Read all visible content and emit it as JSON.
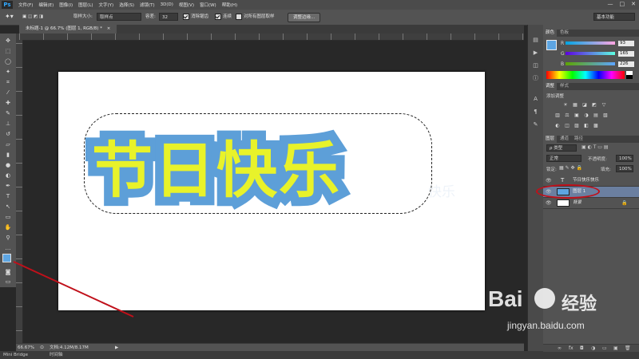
{
  "app": {
    "logo": "Ps"
  },
  "menu": [
    "文件(F)",
    "编辑(E)",
    "图像(I)",
    "图层(L)",
    "文字(Y)",
    "选择(S)",
    "滤镜(T)",
    "3D(D)",
    "视图(V)",
    "窗口(W)",
    "帮助(H)"
  ],
  "window_controls": [
    "—",
    "□",
    "✕"
  ],
  "options": {
    "sample_size_label": "取样大小:",
    "sample_size_value": "取样点",
    "tolerance_label": "容差:",
    "tolerance_value": "32",
    "antialias_label": "消除锯齿",
    "contiguous_label": "连续",
    "all_layers_label": "对所有图层取样",
    "refine_edge_button": "调整边缘...",
    "workspace": "基本功能"
  },
  "document": {
    "tab_title": "未标题-1 @ 66.7% (图层 1, RGB/8) *",
    "tab_close": "×",
    "text": "节日快乐",
    "ghost_text": "快乐"
  },
  "status": {
    "zoom": "66.67%",
    "doc_size": "文档:4.12M/8.17M",
    "arrow": "▶"
  },
  "bottom_tabs": [
    "Mini Bridge",
    "时间轴"
  ],
  "color_panel": {
    "tabs": [
      "颜色",
      "色板"
    ],
    "channels": [
      {
        "label": "R",
        "value": "93"
      },
      {
        "label": "G",
        "value": "165"
      },
      {
        "label": "B",
        "value": "226"
      }
    ],
    "foreground": "#5da5e2"
  },
  "adjustments_panel": {
    "tabs": [
      "调整",
      "样式"
    ],
    "heading": "添加调整",
    "icons": [
      "☀",
      "▦",
      "◪",
      "◩",
      "▽",
      "▥",
      "⚖",
      "▣",
      "◑",
      "▤",
      "▧",
      "◐",
      "◫",
      "▨",
      "◧",
      "▩"
    ]
  },
  "layers_panel": {
    "tabs": [
      "图层",
      "通道",
      "路径"
    ],
    "kind_label": "ρ 类型",
    "blend_mode": "正常",
    "opacity_label": "不透明度:",
    "opacity_value": "100%",
    "lock_label": "锁定:",
    "fill_label": "填充:",
    "fill_value": "100%",
    "layers": [
      {
        "name": "节日快乐快乐",
        "type": "T",
        "selected": false
      },
      {
        "name": "图层 1",
        "type": "pixel",
        "selected": true
      },
      {
        "name": "背景",
        "type": "background",
        "selected": false
      }
    ],
    "footer_icons": [
      "∞",
      "fx",
      "◘",
      "◑",
      "▭",
      "▣",
      "🗑"
    ]
  },
  "watermark": {
    "brand": "Bai",
    "brand2": "经验",
    "url": "jingyan.baidu.com"
  }
}
